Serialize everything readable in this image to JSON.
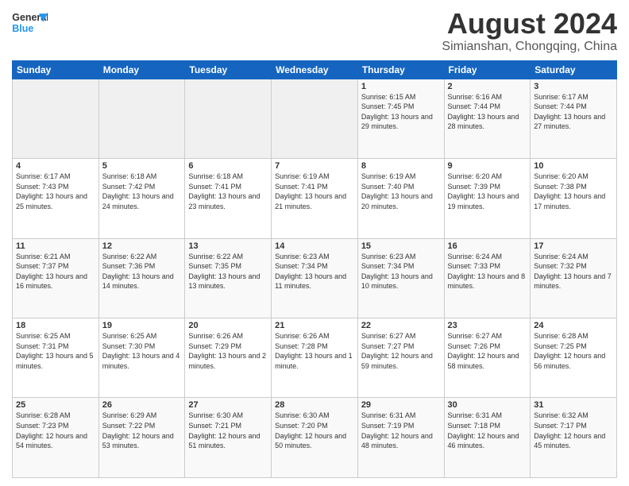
{
  "header": {
    "logo_general": "General",
    "logo_blue": "Blue",
    "month": "August 2024",
    "location": "Simianshan, Chongqing, China"
  },
  "days_of_week": [
    "Sunday",
    "Monday",
    "Tuesday",
    "Wednesday",
    "Thursday",
    "Friday",
    "Saturday"
  ],
  "weeks": [
    [
      {
        "day": "",
        "sunrise": "",
        "sunset": "",
        "daylight": ""
      },
      {
        "day": "",
        "sunrise": "",
        "sunset": "",
        "daylight": ""
      },
      {
        "day": "",
        "sunrise": "",
        "sunset": "",
        "daylight": ""
      },
      {
        "day": "",
        "sunrise": "",
        "sunset": "",
        "daylight": ""
      },
      {
        "day": "1",
        "sunrise": "Sunrise: 6:15 AM",
        "sunset": "Sunset: 7:45 PM",
        "daylight": "Daylight: 13 hours and 29 minutes."
      },
      {
        "day": "2",
        "sunrise": "Sunrise: 6:16 AM",
        "sunset": "Sunset: 7:44 PM",
        "daylight": "Daylight: 13 hours and 28 minutes."
      },
      {
        "day": "3",
        "sunrise": "Sunrise: 6:17 AM",
        "sunset": "Sunset: 7:44 PM",
        "daylight": "Daylight: 13 hours and 27 minutes."
      }
    ],
    [
      {
        "day": "4",
        "sunrise": "Sunrise: 6:17 AM",
        "sunset": "Sunset: 7:43 PM",
        "daylight": "Daylight: 13 hours and 25 minutes."
      },
      {
        "day": "5",
        "sunrise": "Sunrise: 6:18 AM",
        "sunset": "Sunset: 7:42 PM",
        "daylight": "Daylight: 13 hours and 24 minutes."
      },
      {
        "day": "6",
        "sunrise": "Sunrise: 6:18 AM",
        "sunset": "Sunset: 7:41 PM",
        "daylight": "Daylight: 13 hours and 23 minutes."
      },
      {
        "day": "7",
        "sunrise": "Sunrise: 6:19 AM",
        "sunset": "Sunset: 7:41 PM",
        "daylight": "Daylight: 13 hours and 21 minutes."
      },
      {
        "day": "8",
        "sunrise": "Sunrise: 6:19 AM",
        "sunset": "Sunset: 7:40 PM",
        "daylight": "Daylight: 13 hours and 20 minutes."
      },
      {
        "day": "9",
        "sunrise": "Sunrise: 6:20 AM",
        "sunset": "Sunset: 7:39 PM",
        "daylight": "Daylight: 13 hours and 19 minutes."
      },
      {
        "day": "10",
        "sunrise": "Sunrise: 6:20 AM",
        "sunset": "Sunset: 7:38 PM",
        "daylight": "Daylight: 13 hours and 17 minutes."
      }
    ],
    [
      {
        "day": "11",
        "sunrise": "Sunrise: 6:21 AM",
        "sunset": "Sunset: 7:37 PM",
        "daylight": "Daylight: 13 hours and 16 minutes."
      },
      {
        "day": "12",
        "sunrise": "Sunrise: 6:22 AM",
        "sunset": "Sunset: 7:36 PM",
        "daylight": "Daylight: 13 hours and 14 minutes."
      },
      {
        "day": "13",
        "sunrise": "Sunrise: 6:22 AM",
        "sunset": "Sunset: 7:35 PM",
        "daylight": "Daylight: 13 hours and 13 minutes."
      },
      {
        "day": "14",
        "sunrise": "Sunrise: 6:23 AM",
        "sunset": "Sunset: 7:34 PM",
        "daylight": "Daylight: 13 hours and 11 minutes."
      },
      {
        "day": "15",
        "sunrise": "Sunrise: 6:23 AM",
        "sunset": "Sunset: 7:34 PM",
        "daylight": "Daylight: 13 hours and 10 minutes."
      },
      {
        "day": "16",
        "sunrise": "Sunrise: 6:24 AM",
        "sunset": "Sunset: 7:33 PM",
        "daylight": "Daylight: 13 hours and 8 minutes."
      },
      {
        "day": "17",
        "sunrise": "Sunrise: 6:24 AM",
        "sunset": "Sunset: 7:32 PM",
        "daylight": "Daylight: 13 hours and 7 minutes."
      }
    ],
    [
      {
        "day": "18",
        "sunrise": "Sunrise: 6:25 AM",
        "sunset": "Sunset: 7:31 PM",
        "daylight": "Daylight: 13 hours and 5 minutes."
      },
      {
        "day": "19",
        "sunrise": "Sunrise: 6:25 AM",
        "sunset": "Sunset: 7:30 PM",
        "daylight": "Daylight: 13 hours and 4 minutes."
      },
      {
        "day": "20",
        "sunrise": "Sunrise: 6:26 AM",
        "sunset": "Sunset: 7:29 PM",
        "daylight": "Daylight: 13 hours and 2 minutes."
      },
      {
        "day": "21",
        "sunrise": "Sunrise: 6:26 AM",
        "sunset": "Sunset: 7:28 PM",
        "daylight": "Daylight: 13 hours and 1 minute."
      },
      {
        "day": "22",
        "sunrise": "Sunrise: 6:27 AM",
        "sunset": "Sunset: 7:27 PM",
        "daylight": "Daylight: 12 hours and 59 minutes."
      },
      {
        "day": "23",
        "sunrise": "Sunrise: 6:27 AM",
        "sunset": "Sunset: 7:26 PM",
        "daylight": "Daylight: 12 hours and 58 minutes."
      },
      {
        "day": "24",
        "sunrise": "Sunrise: 6:28 AM",
        "sunset": "Sunset: 7:25 PM",
        "daylight": "Daylight: 12 hours and 56 minutes."
      }
    ],
    [
      {
        "day": "25",
        "sunrise": "Sunrise: 6:28 AM",
        "sunset": "Sunset: 7:23 PM",
        "daylight": "Daylight: 12 hours and 54 minutes."
      },
      {
        "day": "26",
        "sunrise": "Sunrise: 6:29 AM",
        "sunset": "Sunset: 7:22 PM",
        "daylight": "Daylight: 12 hours and 53 minutes."
      },
      {
        "day": "27",
        "sunrise": "Sunrise: 6:30 AM",
        "sunset": "Sunset: 7:21 PM",
        "daylight": "Daylight: 12 hours and 51 minutes."
      },
      {
        "day": "28",
        "sunrise": "Sunrise: 6:30 AM",
        "sunset": "Sunset: 7:20 PM",
        "daylight": "Daylight: 12 hours and 50 minutes."
      },
      {
        "day": "29",
        "sunrise": "Sunrise: 6:31 AM",
        "sunset": "Sunset: 7:19 PM",
        "daylight": "Daylight: 12 hours and 48 minutes."
      },
      {
        "day": "30",
        "sunrise": "Sunrise: 6:31 AM",
        "sunset": "Sunset: 7:18 PM",
        "daylight": "Daylight: 12 hours and 46 minutes."
      },
      {
        "day": "31",
        "sunrise": "Sunrise: 6:32 AM",
        "sunset": "Sunset: 7:17 PM",
        "daylight": "Daylight: 12 hours and 45 minutes."
      }
    ]
  ]
}
